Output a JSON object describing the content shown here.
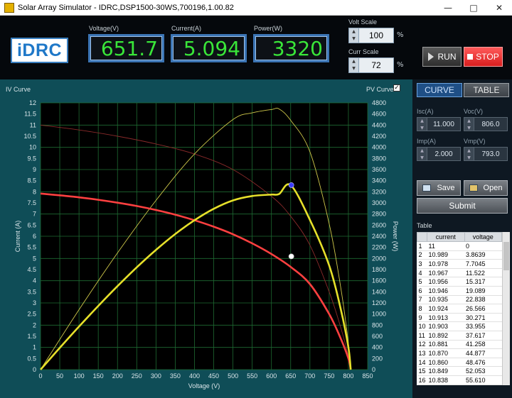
{
  "window": {
    "title": "Solar Array Simulator - IDRC,DSP1500-30WS,700196,1.00.82",
    "minimize": "—",
    "maximize": "□",
    "close": "✕"
  },
  "logo": {
    "text": "iDRC"
  },
  "meters": {
    "voltage": {
      "label": "Voltage(V)",
      "value": "651.7"
    },
    "current": {
      "label": "Current(A)",
      "value": "5.094"
    },
    "power": {
      "label": "Power(W)",
      "value": "3320"
    }
  },
  "scales": {
    "volt": {
      "label": "Volt Scale",
      "value": "100",
      "unit": "%"
    },
    "curr": {
      "label": "Curr Scale",
      "value": "72",
      "unit": "%"
    }
  },
  "buttons": {
    "run": "RUN",
    "stop": "STOP",
    "save": "Save",
    "open": "Open",
    "submit": "Submit"
  },
  "tabs": {
    "curve": "CURVE",
    "table": "TABLE"
  },
  "params": {
    "isc": {
      "label": "Isc(A)",
      "value": "11.000"
    },
    "voc": {
      "label": "Voc(V)",
      "value": "806.0"
    },
    "imp": {
      "label": "Imp(A)",
      "value": "2.000"
    },
    "vmp": {
      "label": "Vmp(V)",
      "value": "793.0"
    }
  },
  "plot": {
    "iv_caption": "IV Curve",
    "pv_caption": "PV Curve",
    "pv_checked": true
  },
  "table": {
    "caption": "Table",
    "headers": [
      "",
      "current",
      "voltage"
    ],
    "rows": [
      [
        "1",
        "11",
        "0"
      ],
      [
        "2",
        "10.989",
        "3.8639"
      ],
      [
        "3",
        "10.978",
        "7.7045"
      ],
      [
        "4",
        "10.967",
        "11.522"
      ],
      [
        "5",
        "10.956",
        "15.317"
      ],
      [
        "6",
        "10.946",
        "19.089"
      ],
      [
        "7",
        "10.935",
        "22.838"
      ],
      [
        "8",
        "10.924",
        "26.566"
      ],
      [
        "9",
        "10.913",
        "30.271"
      ],
      [
        "10",
        "10.903",
        "33.955"
      ],
      [
        "11",
        "10.892",
        "37.617"
      ],
      [
        "12",
        "10.881",
        "41.258"
      ],
      [
        "13",
        "10.870",
        "44.877"
      ],
      [
        "14",
        "10.860",
        "48.476"
      ],
      [
        "15",
        "10.849",
        "52.053"
      ],
      [
        "16",
        "10.838",
        "55.610"
      ]
    ]
  },
  "chart_data": {
    "type": "line",
    "xlabel": "Voltage (V)",
    "ylabel": "Current (A)",
    "y2label": "Power (W)",
    "xlim": [
      0,
      850
    ],
    "ylim": [
      0,
      12
    ],
    "y2lim": [
      0,
      4800
    ],
    "x_ticks": [
      0,
      50,
      100,
      150,
      200,
      250,
      300,
      350,
      400,
      450,
      500,
      550,
      600,
      650,
      700,
      750,
      800,
      850
    ],
    "y_ticks": [
      0,
      0.5,
      1,
      1.5,
      2,
      2.5,
      3,
      3.5,
      4,
      4.5,
      5,
      5.5,
      6,
      6.5,
      7,
      7.5,
      8,
      8.5,
      9,
      9.5,
      10,
      10.5,
      11,
      11.5,
      12
    ],
    "y2_ticks": [
      0,
      200,
      400,
      600,
      800,
      1000,
      1200,
      1400,
      1600,
      1800,
      2000,
      2200,
      2400,
      2600,
      2800,
      3000,
      3200,
      3400,
      3600,
      3800,
      4000,
      4200,
      4400,
      4600,
      4800
    ],
    "grid": true,
    "series": [
      {
        "color": "#ff4040",
        "axis": "left",
        "x": [
          0,
          50,
          100,
          150,
          200,
          250,
          300,
          350,
          400,
          450,
          500,
          550,
          600,
          650,
          700,
          750,
          780,
          800,
          806
        ],
        "y": [
          7.92,
          7.84,
          7.75,
          7.64,
          7.51,
          7.36,
          7.18,
          6.97,
          6.72,
          6.43,
          6.09,
          5.68,
          5.2,
          4.62,
          3.85,
          2.5,
          1.4,
          0.5,
          0
        ]
      },
      {
        "color": "#e6e02a",
        "axis": "right",
        "x": [
          0,
          50,
          100,
          150,
          200,
          250,
          300,
          350,
          400,
          450,
          500,
          550,
          600,
          620,
          650,
          700,
          750,
          780,
          800,
          806
        ],
        "y": [
          0,
          392,
          775,
          1146,
          1502,
          1840,
          2154,
          2440,
          2688,
          2894,
          3045,
          3124,
          3150,
          3160,
          3320,
          2695,
          1875,
          1092,
          400,
          0
        ]
      },
      {
        "color": "#8a2a2a",
        "axis": "left",
        "x": [
          0,
          100,
          200,
          300,
          400,
          500,
          600,
          650,
          700,
          750,
          780,
          800,
          806
        ],
        "y": [
          11,
          10.78,
          10.5,
          10.15,
          9.7,
          9.0,
          7.8,
          6.9,
          5.6,
          3.5,
          1.9,
          0.6,
          0
        ]
      },
      {
        "color": "#cfc84a",
        "axis": "right",
        "x": [
          0,
          100,
          200,
          300,
          400,
          500,
          550,
          600,
          620,
          650,
          700,
          750,
          780,
          800,
          806
        ],
        "y": [
          0,
          1078,
          2100,
          3045,
          3880,
          4500,
          4620,
          4680,
          4690,
          4485,
          3920,
          2625,
          1482,
          480,
          0
        ]
      }
    ],
    "operating_point": {
      "voltage": 651.7,
      "current": 5.094,
      "power": 3320
    }
  }
}
